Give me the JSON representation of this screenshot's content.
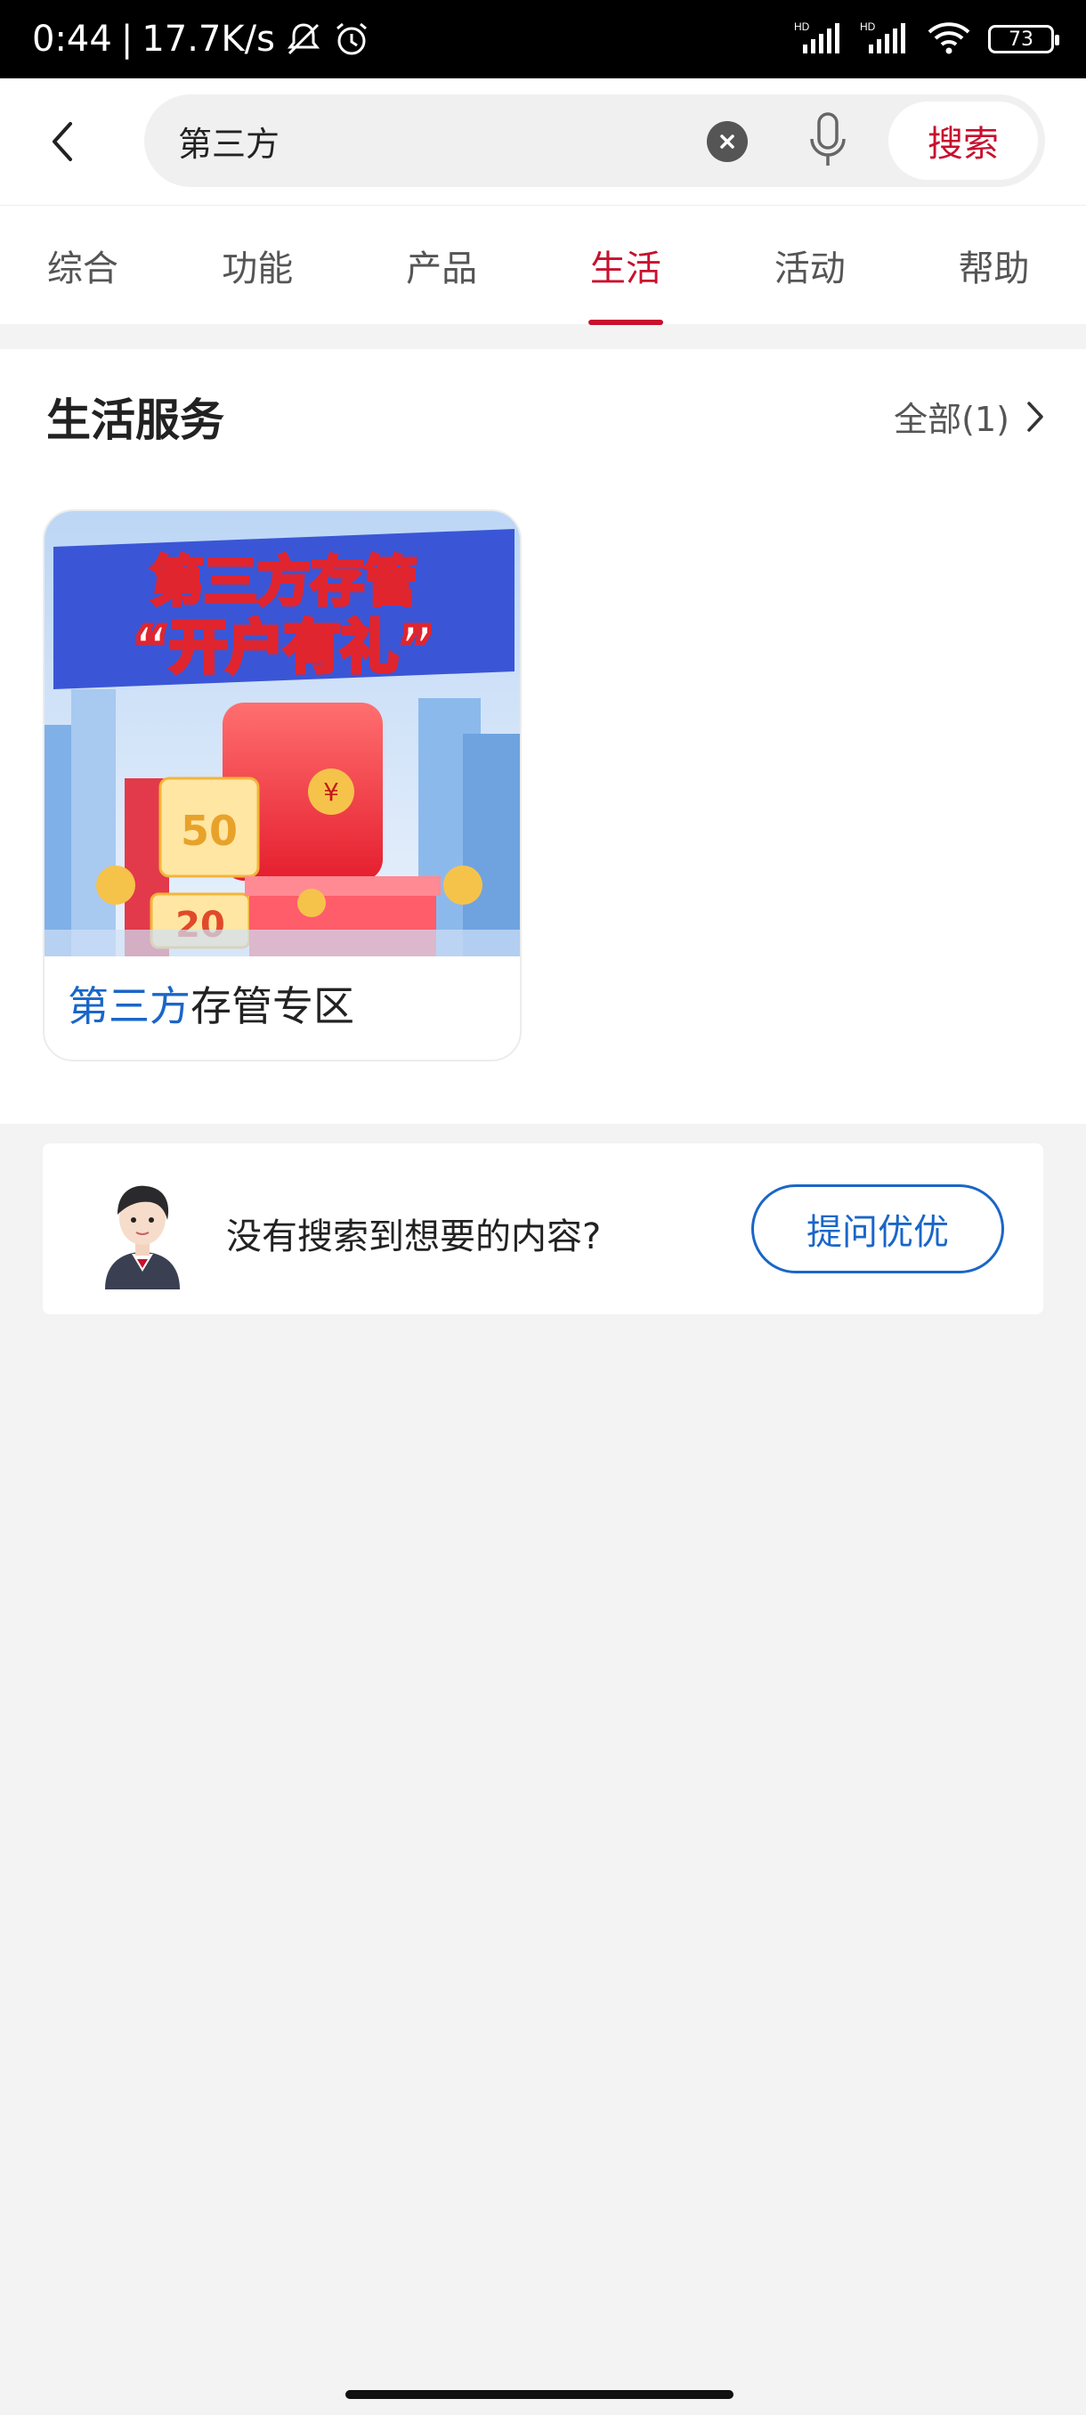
{
  "status_bar": {
    "time": "0:44",
    "net_speed": "17.7K/s",
    "battery": "73",
    "signal1_label": "HD",
    "signal2_label": "HD"
  },
  "search": {
    "query": "第三方",
    "placeholder": "",
    "submit_label": "搜索"
  },
  "tabs": [
    {
      "label": "综合",
      "active": false
    },
    {
      "label": "功能",
      "active": false
    },
    {
      "label": "产品",
      "active": false
    },
    {
      "label": "生活",
      "active": true
    },
    {
      "label": "活动",
      "active": false
    },
    {
      "label": "帮助",
      "active": false
    }
  ],
  "life_section": {
    "title": "生活服务",
    "more_label": "全部(1)",
    "card": {
      "title_highlight": "第三方",
      "title_rest": "存管专区",
      "banner_line1": "第三方存管",
      "banner_line2": "“开户有礼”",
      "coupon1_value": "50",
      "coupon2_value": "20"
    }
  },
  "help": {
    "text": "没有搜索到想要的内容?",
    "button_label": "提问优优"
  },
  "colors": {
    "accent_red": "#c8102e",
    "accent_blue": "#1a66c8"
  }
}
